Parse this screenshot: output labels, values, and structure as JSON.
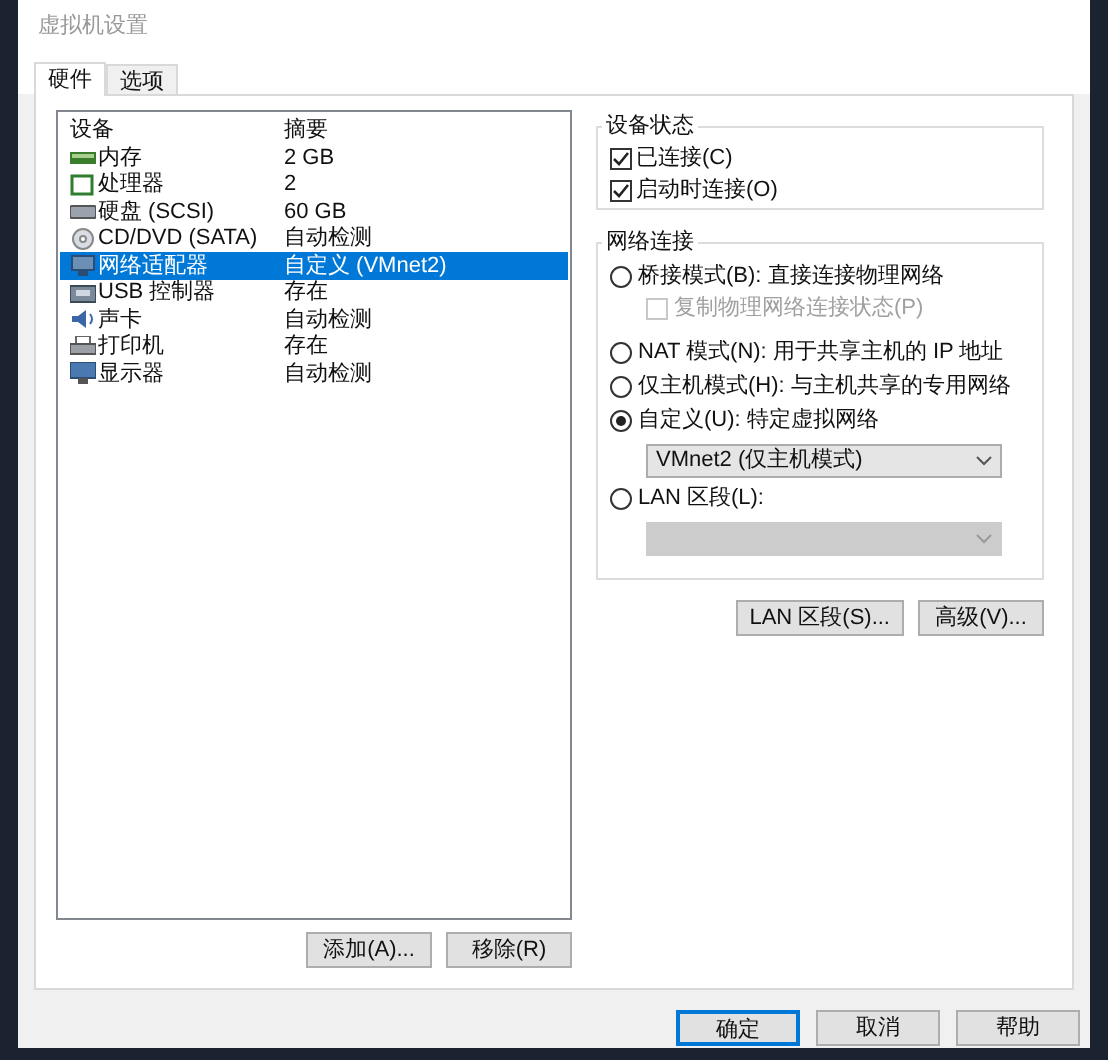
{
  "window": {
    "title": "虚拟机设置"
  },
  "tabs": [
    {
      "label": "硬件",
      "selected": true
    },
    {
      "label": "选项",
      "selected": false
    }
  ],
  "devices": {
    "columns": [
      "设备",
      "摘要"
    ],
    "rows": [
      {
        "kind": "memory",
        "name": "内存",
        "summary": "2 GB",
        "selected": false
      },
      {
        "kind": "cpu",
        "name": "处理器",
        "summary": "2",
        "selected": false
      },
      {
        "kind": "disk",
        "name": "硬盘 (SCSI)",
        "summary": "60 GB",
        "selected": false
      },
      {
        "kind": "cdrom",
        "name": "CD/DVD (SATA)",
        "summary": "自动检测",
        "selected": false
      },
      {
        "kind": "network",
        "name": "网络适配器",
        "summary": "自定义 (VMnet2)",
        "selected": true
      },
      {
        "kind": "usb",
        "name": "USB 控制器",
        "summary": "存在",
        "selected": false
      },
      {
        "kind": "sound",
        "name": "声卡",
        "summary": "自动检测",
        "selected": false
      },
      {
        "kind": "printer",
        "name": "打印机",
        "summary": "存在",
        "selected": false
      },
      {
        "kind": "display",
        "name": "显示器",
        "summary": "自动检测",
        "selected": false
      }
    ],
    "buttons": [
      "添加(A)...",
      "移除(R)"
    ]
  },
  "device_status": {
    "title": "设备状态",
    "items": [
      {
        "label": "已连接(C)",
        "checked": true
      },
      {
        "label": "启动时连接(O)",
        "checked": true
      }
    ]
  },
  "network": {
    "title": "网络连接",
    "items": [
      {
        "kind": "radio",
        "label": "桥接模式(B): 直接连接物理网络",
        "selected": false
      },
      {
        "kind": "checkbox",
        "label": "复制物理网络连接状态(P)",
        "checked": false,
        "disabled": true
      },
      {
        "kind": "radio",
        "label": "NAT 模式(N): 用于共享主机的 IP 地址",
        "selected": false
      },
      {
        "kind": "radio",
        "label": "仅主机模式(H): 与主机共享的专用网络",
        "selected": false
      },
      {
        "kind": "radio",
        "label": "自定义(U): 特定虚拟网络",
        "selected": true
      },
      {
        "kind": "select",
        "value": "VMnet2 (仅主机模式)",
        "disabled": false
      },
      {
        "kind": "radio",
        "label": "LAN 区段(L):",
        "selected": false
      },
      {
        "kind": "select",
        "disabled": true
      }
    ],
    "buttons": [
      "LAN 区段(S)...",
      "高级(V)..."
    ]
  },
  "footer_buttons": [
    {
      "label": "确定",
      "default": true
    },
    {
      "label": "取消",
      "default": false
    },
    {
      "label": "帮助",
      "default": false
    }
  ]
}
